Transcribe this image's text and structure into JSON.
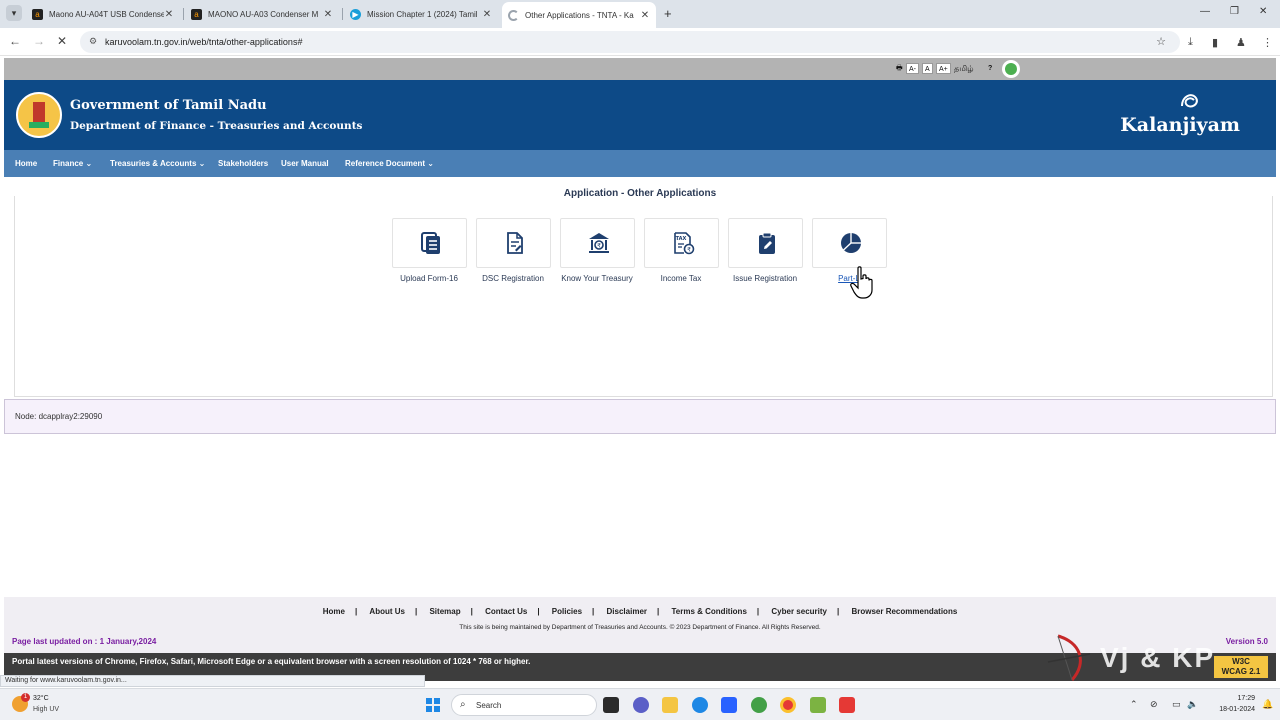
{
  "browser": {
    "tabs": [
      {
        "title": "Maono AU-A04T USB Condense",
        "active": false,
        "icon": "amazon-icon"
      },
      {
        "title": "MAONO AU-A03 Condenser M",
        "active": false,
        "icon": "amazon-icon"
      },
      {
        "title": "Mission Chapter 1 (2024) Tamil",
        "active": false,
        "icon": "video-icon"
      },
      {
        "title": "Other Applications - TNTA - Ka",
        "active": true,
        "icon": "loading-icon"
      }
    ],
    "url": "karuvoolam.tn.gov.in/web/tnta/other-applications#",
    "status_text": "Waiting for www.karuvoolam.tn.gov.in..."
  },
  "utility_bar": {
    "font_small": "A-",
    "font_normal": "A",
    "font_large": "A+",
    "language": "தமிழ்",
    "help": "?"
  },
  "header": {
    "title": "Government of Tamil Nadu",
    "subtitle": "Department of Finance - Treasuries and Accounts",
    "brand": "Kalanjiyam"
  },
  "menu": [
    {
      "label": "Home",
      "dropdown": false
    },
    {
      "label": "Finance",
      "dropdown": true
    },
    {
      "label": "Treasuries & Accounts",
      "dropdown": true
    },
    {
      "label": "Stakeholders",
      "dropdown": false
    },
    {
      "label": "User Manual",
      "dropdown": false
    },
    {
      "label": "Reference Document",
      "dropdown": true
    }
  ],
  "panel": {
    "title": "Application - Other Applications",
    "apps": [
      {
        "label": "Upload Form-16",
        "icon": "list-document-icon"
      },
      {
        "label": "DSC Registration",
        "icon": "document-edit-icon"
      },
      {
        "label": "Know Your Treasury",
        "icon": "bank-building-icon"
      },
      {
        "label": "Income Tax",
        "icon": "tax-document-icon"
      },
      {
        "label": "Issue Registration",
        "icon": "clipboard-edit-icon"
      },
      {
        "label": "Part-L",
        "icon": "pie-chart-icon"
      }
    ]
  },
  "node": {
    "text": "Node: dcapplray2:29090"
  },
  "footer": {
    "links": [
      "Home",
      "About Us",
      "Sitemap",
      "Contact Us",
      "Policies",
      "Disclaimer",
      "Terms & Conditions",
      "Cyber security",
      "Browser Recommendations"
    ],
    "separator": "|",
    "maintained": "This site is being maintained by Department of Treasuries and Accounts. © 2023 Department of Finance. All Rights Reserved.",
    "updated": "Page last updated on : 1 January,2024",
    "version": "Version 5.0",
    "browser_note": "Portal latest versions of Chrome, Firefox, Safari, Microsoft Edge or a equivalent browser with a screen resolution of 1024 * 768 or higher.",
    "wcag_line1": "W3C",
    "wcag_line2": "WCAG 2.1",
    "watermark": "Vj & KP"
  },
  "taskbar": {
    "temperature": "32°C",
    "uv": "High UV",
    "weather_badge": "1",
    "search_placeholder": "Search",
    "time": "17:29",
    "date": "18-01-2024"
  },
  "colors": {
    "header_blue": "#0d4a87",
    "menu_blue": "#4a7fb5",
    "icon_navy": "#1f3f6e",
    "footer_purple": "#7a1fa2"
  }
}
